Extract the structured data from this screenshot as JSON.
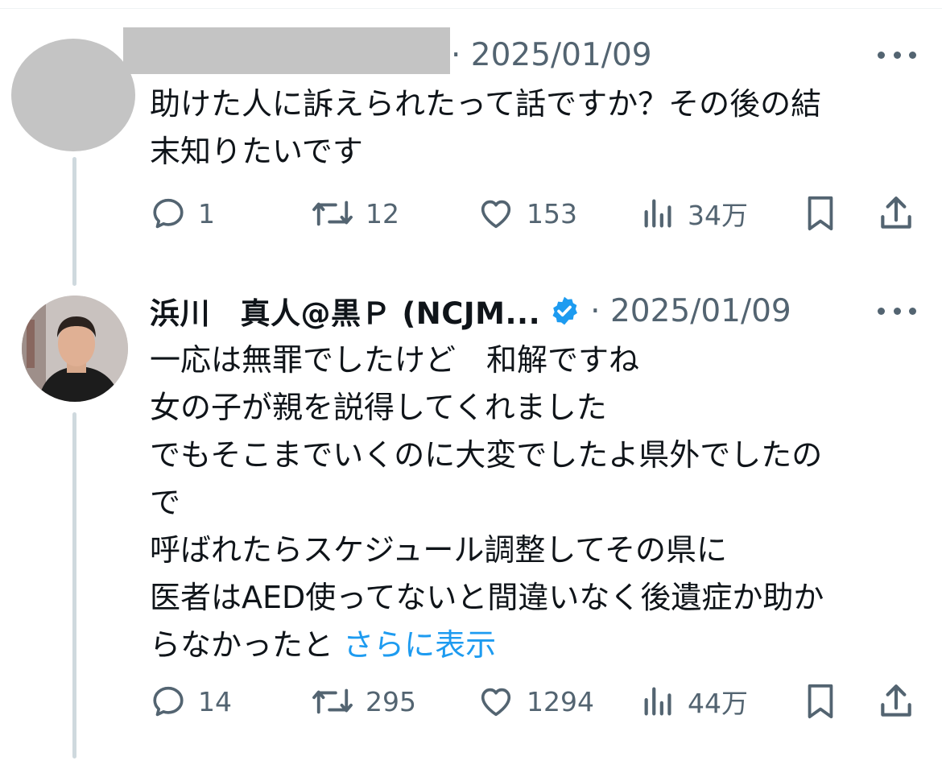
{
  "tweets": [
    {
      "author": {
        "name": "",
        "verified": false
      },
      "date": "· 2025/01/09",
      "lines": [
        "助けた人に訴えられたって話ですか？その後の結",
        "末知りたいです"
      ],
      "show_more": "",
      "stats": {
        "replies": "1",
        "retweets": "12",
        "likes": "153",
        "views": "34万"
      }
    },
    {
      "author": {
        "name": "浜川　真人@黒Ｐ (NCJM...",
        "verified": true
      },
      "date": "· 2025/01/09",
      "lines": [
        "一応は無罪でしたけど　和解ですね",
        "女の子が親を説得してくれました",
        "でもそこまでいくのに大変でしたよ県外でしたの",
        "で",
        "呼ばれたらスケジュール調整してその県に",
        "医者はAED使ってないと間違いなく後遺症か助か",
        "らなかったと"
      ],
      "show_more": "さらに表示",
      "stats": {
        "replies": "14",
        "retweets": "295",
        "likes": "1294",
        "views": "44万"
      }
    }
  ],
  "icons": {
    "reply": "speech-bubble-icon",
    "retweet": "retweet-arrows-icon",
    "like": "heart-icon",
    "views": "bar-chart-icon",
    "bookmark": "bookmark-icon",
    "share": "share-upload-icon",
    "more": "ellipsis-icon",
    "verified": "verified-badge-icon"
  },
  "colors": {
    "text": "#0f1419",
    "secondary": "#536471",
    "link": "#1d9bf0",
    "verified": "#1d9bf0",
    "thread_line": "#cfd9de"
  }
}
